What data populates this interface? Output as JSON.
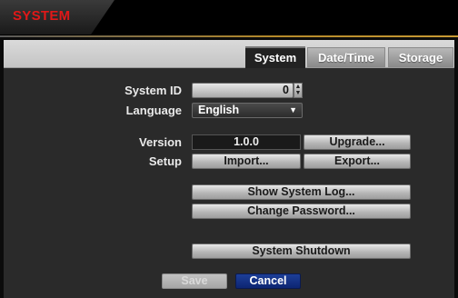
{
  "window": {
    "title": "SYSTEM"
  },
  "tabs": [
    {
      "label": "System",
      "active": true
    },
    {
      "label": "Date/Time",
      "active": false
    },
    {
      "label": "Storage",
      "active": false
    }
  ],
  "form": {
    "system_id_label": "System ID",
    "system_id_value": "0",
    "language_label": "Language",
    "language_value": "English",
    "version_label": "Version",
    "version_value": "1.0.0",
    "upgrade_button": "Upgrade...",
    "setup_label": "Setup",
    "import_button": "Import...",
    "export_button": "Export...",
    "show_log_button": "Show System Log...",
    "change_password_button": "Change Password...",
    "shutdown_button": "System Shutdown"
  },
  "footer": {
    "save_button": "Save",
    "cancel_button": "Cancel"
  },
  "colors": {
    "title_red": "#e01818",
    "cancel_blue": "#1d3f98"
  }
}
